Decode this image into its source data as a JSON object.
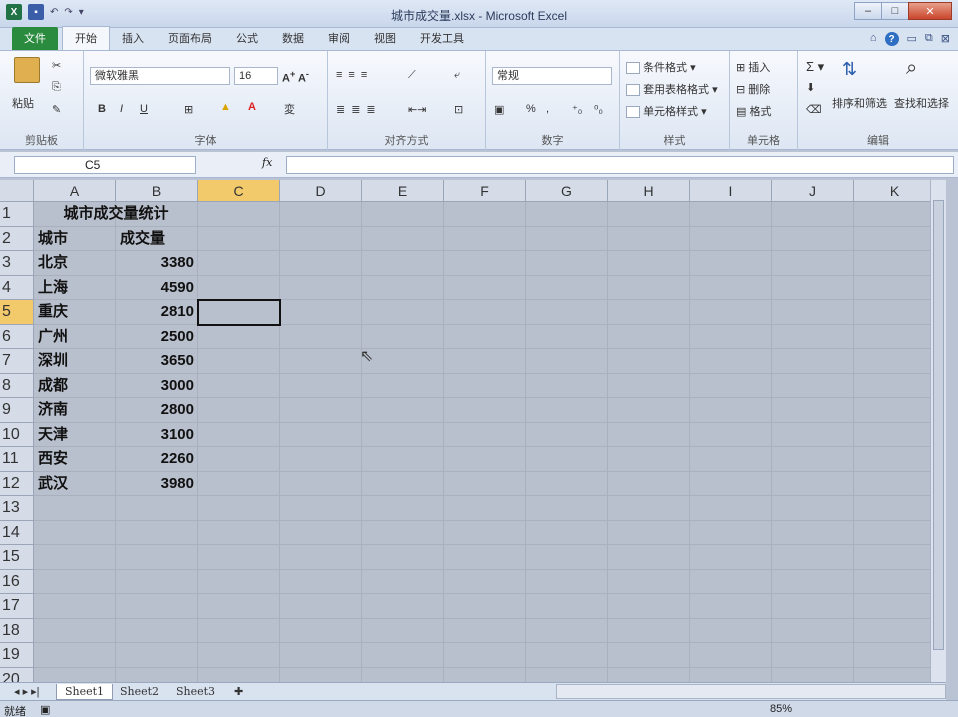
{
  "window": {
    "title": "城市成交量.xlsx - Microsoft Excel"
  },
  "tabs": [
    "文件",
    "开始",
    "插入",
    "页面布局",
    "公式",
    "数据",
    "审阅",
    "视图",
    "开发工具"
  ],
  "ribbon": {
    "clipboard": {
      "label": "剪贴板",
      "paste": "粘贴"
    },
    "font": {
      "label": "字体",
      "name": "微软雅黑",
      "size": "16"
    },
    "alignment": {
      "label": "对齐方式"
    },
    "number": {
      "label": "数字",
      "format": "常规"
    },
    "styles": {
      "label": "样式",
      "conditional": "条件格式",
      "table": "套用表格格式",
      "cell": "单元格样式"
    },
    "cells": {
      "label": "单元格",
      "insert": "插入",
      "delete": "删除",
      "format": "格式"
    },
    "editing": {
      "label": "编辑",
      "sort": "排序和筛选",
      "find": "查找和选择"
    }
  },
  "formula_bar": {
    "name_box": "C5",
    "fx": "fx",
    "value": ""
  },
  "columns": [
    "A",
    "B",
    "C",
    "D",
    "E",
    "F",
    "G",
    "H",
    "I",
    "J",
    "K"
  ],
  "selected_col": "C",
  "rows": [
    "1",
    "2",
    "3",
    "4",
    "5",
    "6",
    "7",
    "8",
    "9",
    "10",
    "11",
    "12",
    "13",
    "14",
    "15",
    "16",
    "17",
    "18",
    "19",
    "20"
  ],
  "selected_row": "5",
  "sheet": {
    "title": "城市成交量统计",
    "headers": {
      "city": "城市",
      "volume": "成交量"
    },
    "data": [
      {
        "city": "北京",
        "volume": "3380"
      },
      {
        "city": "上海",
        "volume": "4590"
      },
      {
        "city": "重庆",
        "volume": "2810"
      },
      {
        "city": "广州",
        "volume": "2500"
      },
      {
        "city": "深圳",
        "volume": "3650"
      },
      {
        "city": "成都",
        "volume": "3000"
      },
      {
        "city": "济南",
        "volume": "2800"
      },
      {
        "city": "天津",
        "volume": "3100"
      },
      {
        "city": "西安",
        "volume": "2260"
      },
      {
        "city": "武汉",
        "volume": "3980"
      }
    ]
  },
  "sheet_tabs": [
    "Sheet1",
    "Sheet2",
    "Sheet3"
  ],
  "status": {
    "ready": "就绪",
    "zoom": "85%"
  }
}
